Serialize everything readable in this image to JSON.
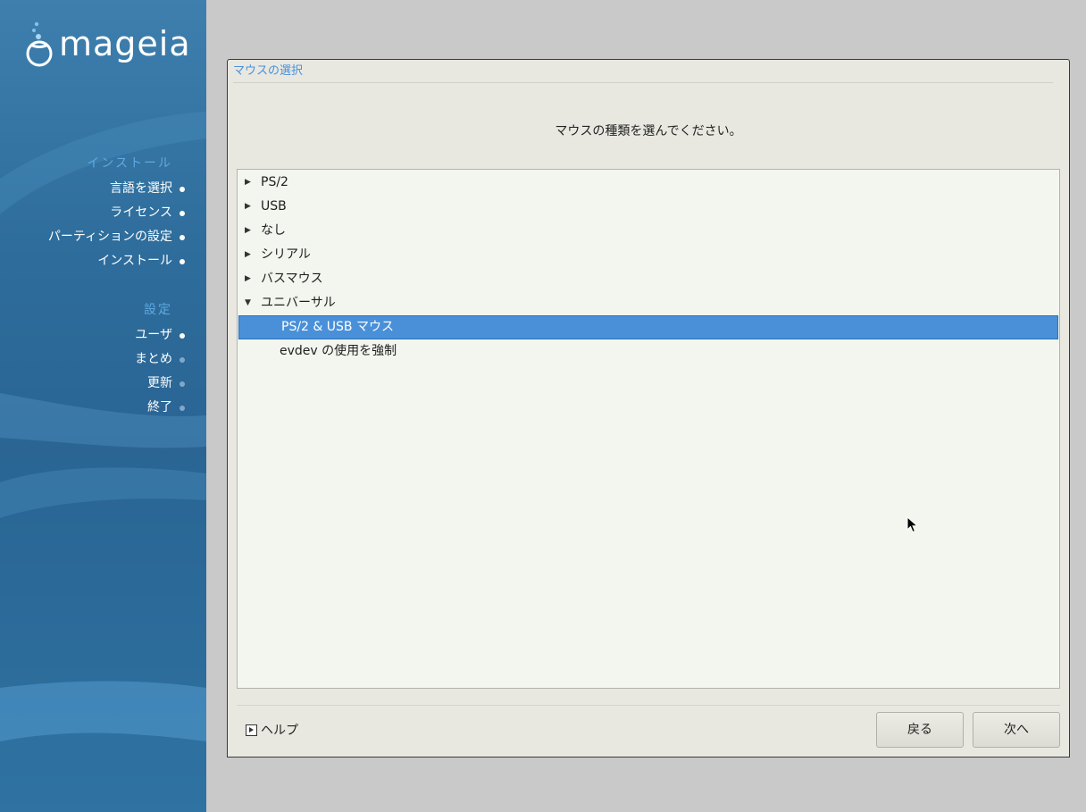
{
  "sidebar": {
    "logo_text": "mageia",
    "install_header": "インストール",
    "install_steps": [
      {
        "label": "言語を選択",
        "done": true
      },
      {
        "label": "ライセンス",
        "done": true
      },
      {
        "label": "パーティションの設定",
        "done": true
      },
      {
        "label": "インストール",
        "done": true
      }
    ],
    "settings_header": "設定",
    "settings_steps": [
      {
        "label": "ユーザ",
        "done": true
      },
      {
        "label": "まとめ",
        "done": false
      },
      {
        "label": "更新",
        "done": false
      },
      {
        "label": "終了",
        "done": false
      }
    ]
  },
  "panel": {
    "title": "マウスの選択",
    "prompt": "マウスの種類を選んでください。",
    "tree": [
      {
        "label": "PS/2",
        "expanded": false
      },
      {
        "label": "USB",
        "expanded": false
      },
      {
        "label": "なし",
        "expanded": false
      },
      {
        "label": "シリアル",
        "expanded": false
      },
      {
        "label": "バスマウス",
        "expanded": false
      },
      {
        "label": "ユニバーサル",
        "expanded": true,
        "children": [
          {
            "label": "PS/2 & USB マウス",
            "selected": true
          },
          {
            "label": "evdev の使用を強制",
            "selected": false
          }
        ]
      }
    ],
    "help_label": "ヘルプ",
    "back_label": "戻る",
    "next_label": "次へ"
  },
  "colors": {
    "accent": "#4a90d9",
    "sidebar_blue": "#2e6d9c",
    "panel_bg": "#e8e8e1",
    "list_bg": "#f2f6ee"
  }
}
